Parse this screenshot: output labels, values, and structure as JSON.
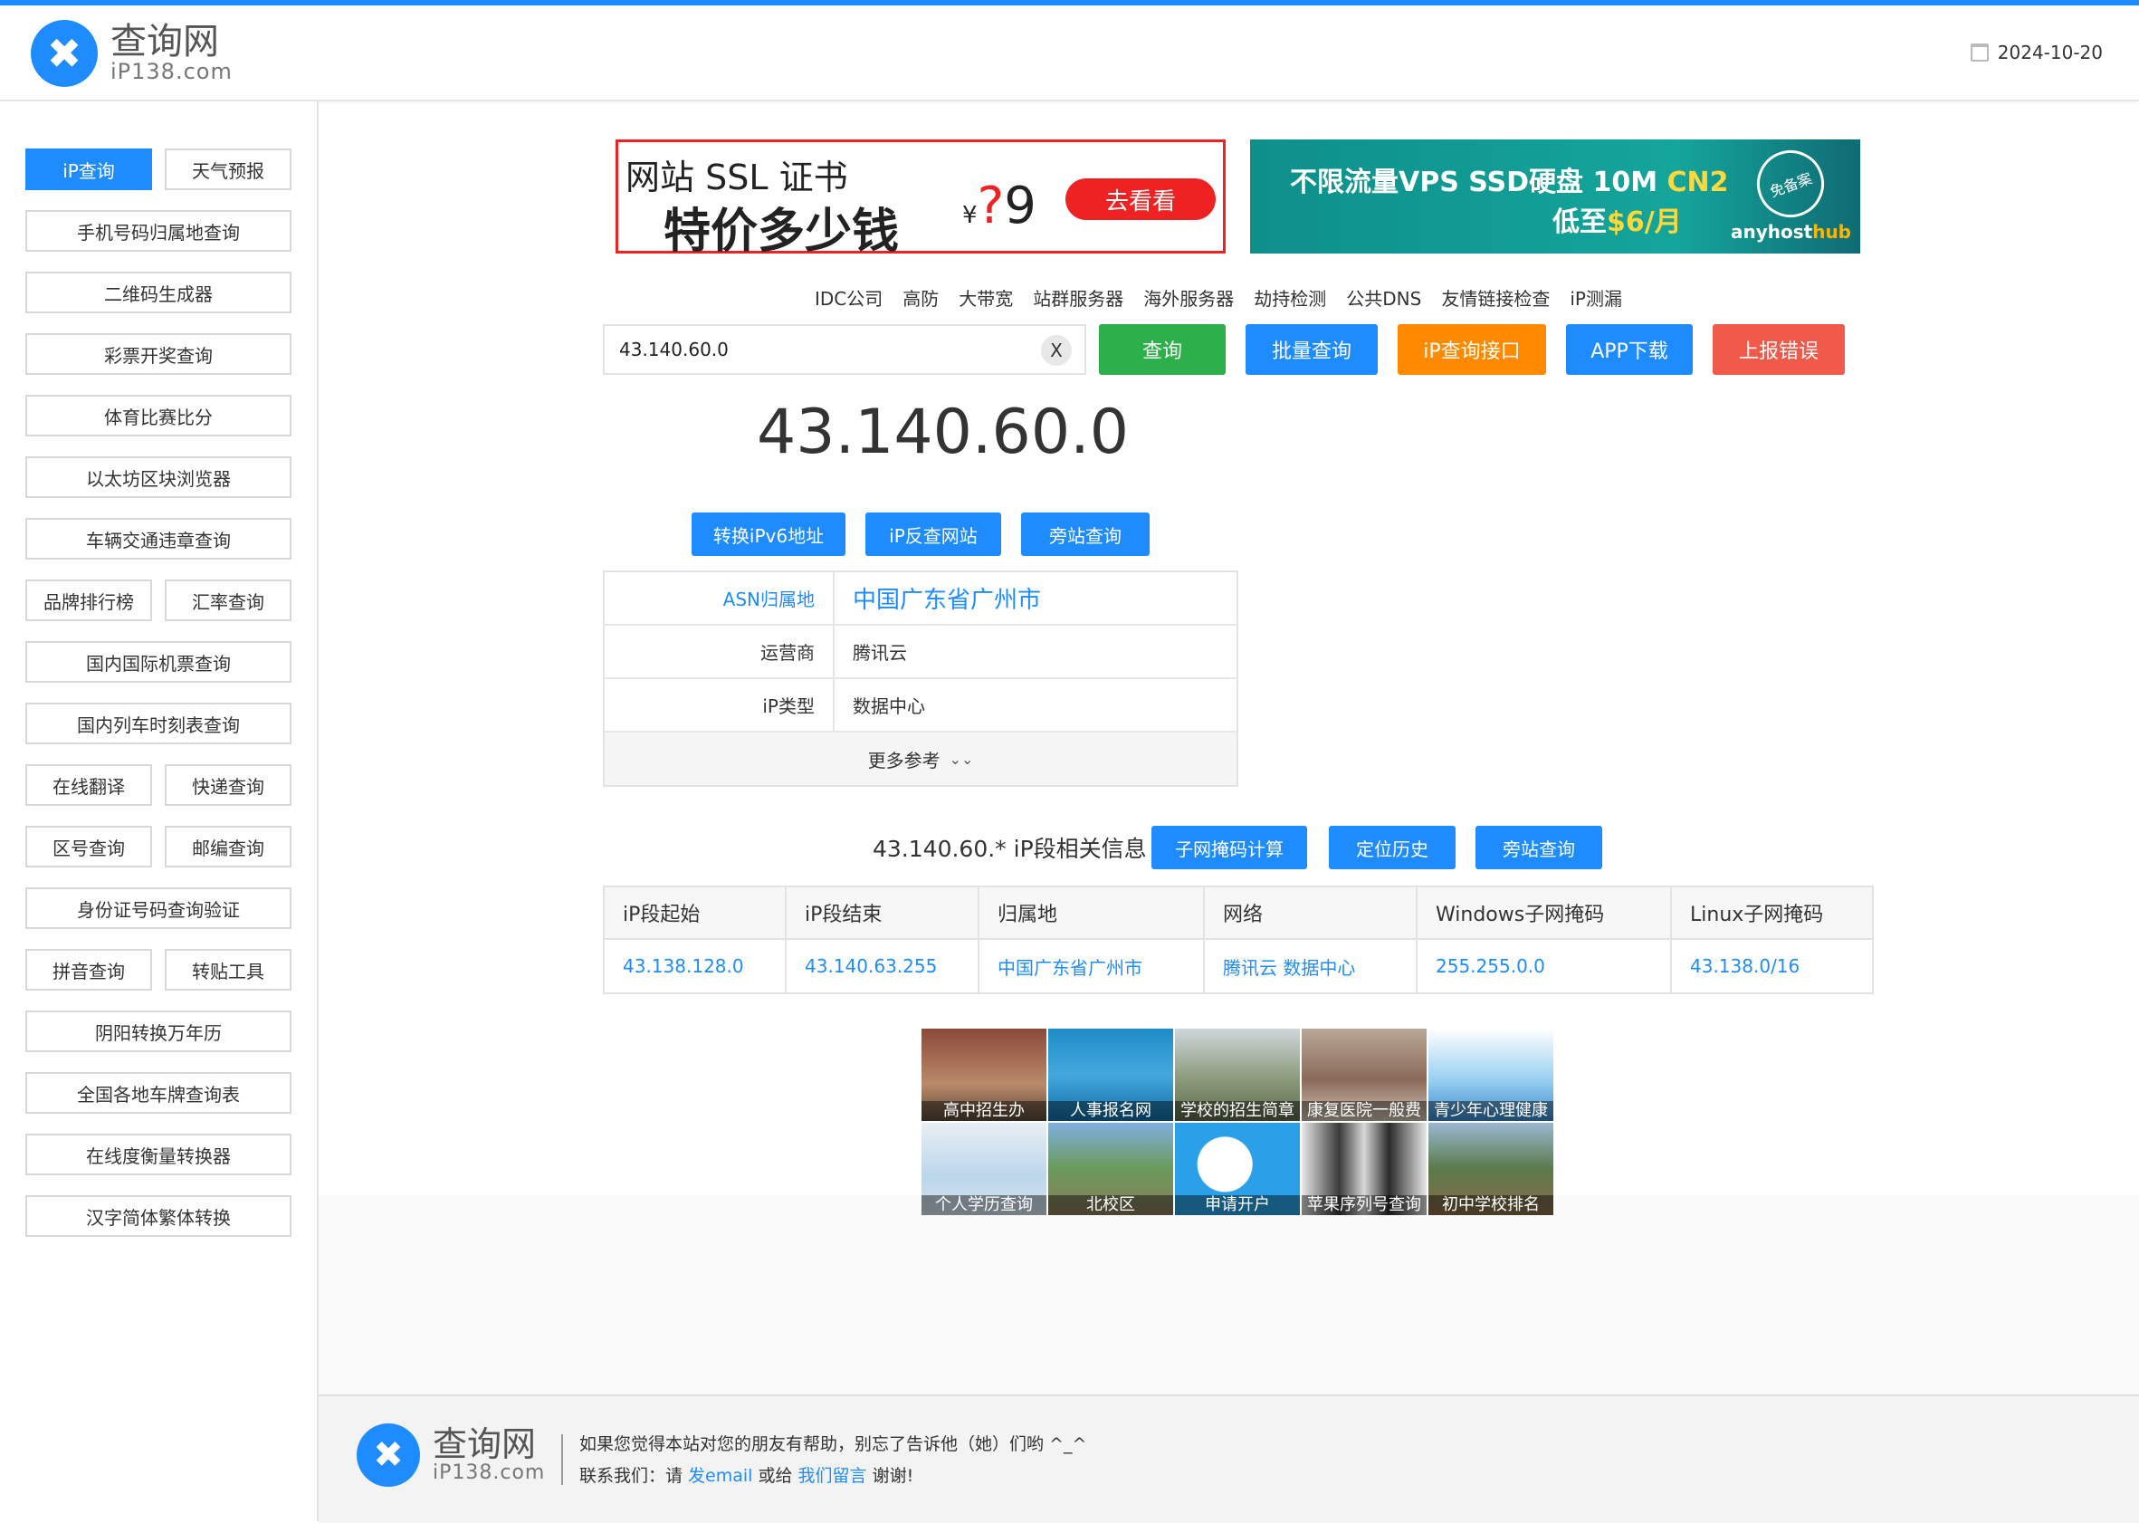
{
  "header": {
    "logo_cn": "查询网",
    "logo_en": "iP138.com",
    "date": "2024-10-20"
  },
  "sidebar": {
    "items": [
      "iP查询",
      "天气预报",
      "手机号码归属地查询",
      "二维码生成器",
      "彩票开奖查询",
      "体育比赛比分",
      "以太坊区块浏览器",
      "车辆交通违章查询",
      "品牌排行榜",
      "汇率查询",
      "国内国际机票查询",
      "国内列车时刻表查询",
      "在线翻译",
      "快递查询",
      "区号查询",
      "邮编查询",
      "身份证号码查询验证",
      "拼音查询",
      "转贴工具",
      "阴阳转换万年历",
      "全国各地车牌查询表",
      "在线度衡量转换器",
      "汉字简体繁体转换"
    ]
  },
  "ads": {
    "ssl": {
      "line1": "网站 SSL 证书",
      "line2": "特价多少钱",
      "price_symbol": "¥",
      "price_mark": "?",
      "price_num": "9",
      "button": "去看看"
    },
    "vps": {
      "line1": "不限流量VPS SSD硬盘 10M ",
      "line1_accent": "CN2",
      "line2": "低至",
      "line2_price": "$6/月",
      "seal": "免备案",
      "brand": "anyhost",
      "brand_accent": "hub"
    }
  },
  "quicklinks": [
    "IDC公司",
    "高防",
    "大带宽",
    "站群服务器",
    "海外服务器",
    "劫持检测",
    "公共DNS",
    "友情链接检查",
    "iP测漏"
  ],
  "search": {
    "value": "43.140.60.0",
    "clear": "X"
  },
  "actions": {
    "query": "查询",
    "batch": "批量查询",
    "api": "iP查询接口",
    "app": "APP下载",
    "report": "上报错误"
  },
  "colors": {
    "accent": "#1e8cff",
    "green": "#2daf4a",
    "orange": "#ff8a00",
    "red": "#f15a4a"
  },
  "result": {
    "ip": "43.140.60.0",
    "buttons": [
      "转换iPv6地址",
      "iP反查网站",
      "旁站查询"
    ],
    "rows": [
      {
        "k": "ASN归属地",
        "v": "中国广东省广州市"
      },
      {
        "k": "运营商",
        "v": "腾讯云"
      },
      {
        "k": "iP类型",
        "v": "数据中心"
      }
    ],
    "more": "更多参考"
  },
  "segment": {
    "title": "43.140.60.* iP段相关信息",
    "buttons": [
      "子网掩码计算",
      "定位历史",
      "旁站查询"
    ],
    "headers": [
      "iP段起始",
      "iP段结束",
      "归属地",
      "网络",
      "Windows子网掩码",
      "Linux子网掩码"
    ],
    "row": [
      "43.138.128.0",
      "43.140.63.255",
      "中国广东省广州市",
      "腾讯云 数据中心",
      "255.255.0.0",
      "43.138.0/16"
    ]
  },
  "tiles": [
    "高中招生办",
    "人事报名网",
    "学校的招生简章",
    "康复医院一般费",
    "青少年心理健康",
    "个人学历查询",
    "北校区",
    "申请开户",
    "苹果序列号查询",
    "初中学校排名"
  ],
  "footer": {
    "logo_cn": "查询网",
    "logo_en": "iP138.com",
    "line1": "如果您觉得本站对您的朋友有帮助，别忘了告诉他（她）们哟 ^_^",
    "line2_pre": "联系我们：请 ",
    "email": "发email",
    "mid": " 或给 ",
    "msg": "我们留言",
    "post": " 谢谢!"
  }
}
